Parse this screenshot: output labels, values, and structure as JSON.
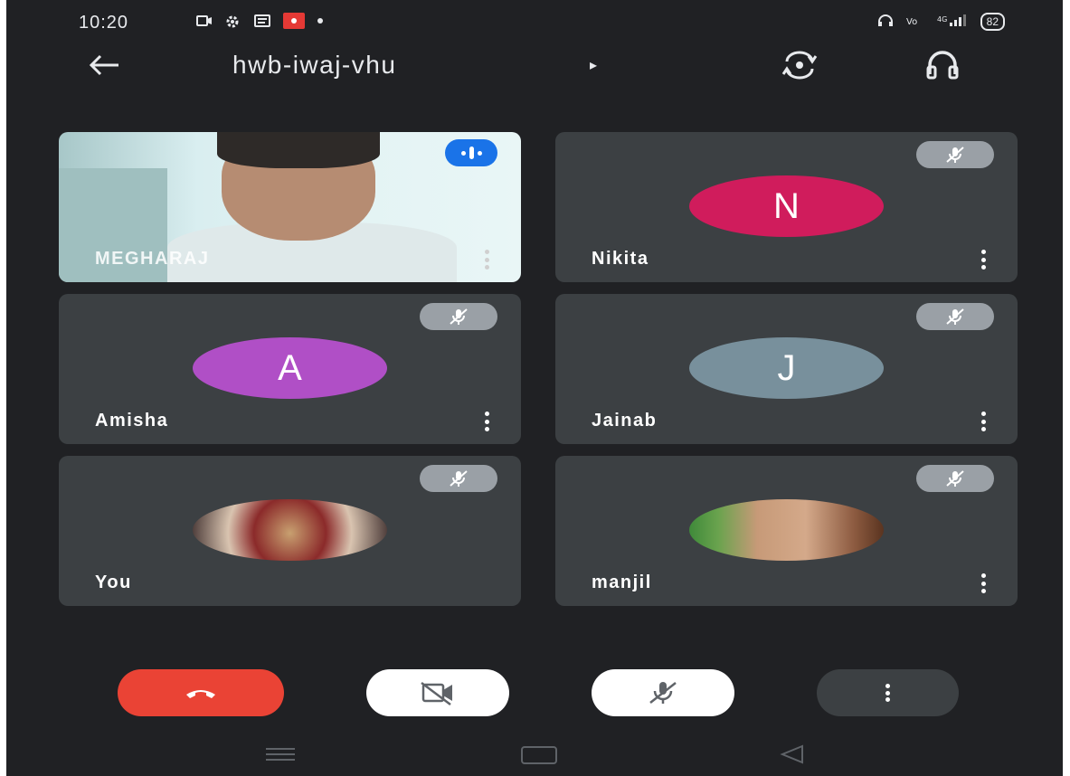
{
  "status_bar": {
    "time": "10:20",
    "battery": "82"
  },
  "top_bar": {
    "title": "hwb-iwaj-vhu",
    "caret": "▸"
  },
  "tiles": [
    {
      "name": "MEGHARAJ",
      "type": "video",
      "speaking": true
    },
    {
      "name": "Nikita",
      "initial": "N",
      "avatar_color": "#d01c5c",
      "muted": true
    },
    {
      "name": "Amisha",
      "initial": "A",
      "avatar_color": "#b04fc6",
      "muted": true
    },
    {
      "name": "Jainab",
      "initial": "J",
      "avatar_color": "#78909c",
      "muted": true
    },
    {
      "name": "You",
      "type": "photo",
      "muted": true
    },
    {
      "name": "manjil",
      "type": "photo",
      "muted": true
    }
  ],
  "controls": {
    "end_call_color": "#ea4335",
    "camera": "off",
    "microphone": "off"
  },
  "colors": {
    "background": "#202124",
    "tile": "#3c4043",
    "speaking_indicator": "#1a73e8"
  }
}
